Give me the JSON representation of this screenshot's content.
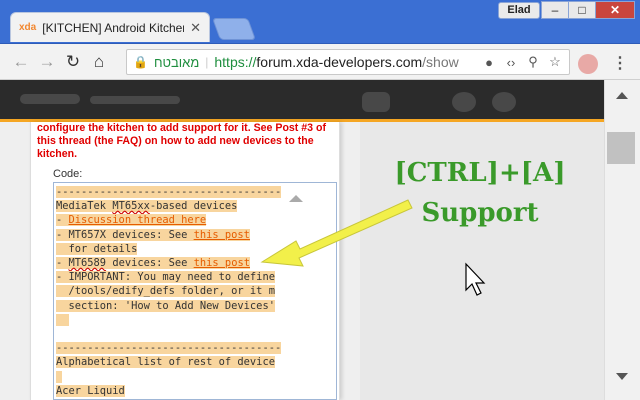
{
  "window": {
    "tab_favicon": "xda",
    "tab_title": "[KITCHEN] Android Kitchen",
    "tab_close": "✕",
    "user": "Elad",
    "minimize": "‒",
    "maximize": "□",
    "close": "✕"
  },
  "toolbar": {
    "back": "←",
    "forward": "→",
    "reload": "↻",
    "home": "⌂",
    "lock": "🔒",
    "secure_label": "מאובטח",
    "url_scheme": "https://",
    "url_host": "forum.xda-developers.com",
    "url_path": "/show",
    "menu": "⋮"
  },
  "post": {
    "red_text": "configure the kitchen to add support for it. See Post #3 of this thread (the FAQ) on how to add new devices to the kitchen.",
    "code_label": "Code:",
    "code": {
      "sep1": "------------------------------------",
      "mtk_prefix": "MediaTek ",
      "mtk_chip": "MT65xx",
      "mtk_suffix": "-based devices",
      "disc_dash": "- ",
      "disc_link": "Discussion thread here",
      "mt657x_text": "- MT657X devices: See ",
      "mt657x_link": "this post",
      "mt657x_details": "  for details",
      "mt6589_dash": "- ",
      "mt6589_chip": "MT6589",
      "mt6589_text": " devices: See ",
      "mt6589_link": "this post",
      "important1": "- IMPORTANT: You may need to define",
      "important2": "  /tools/edify_defs folder, or it m",
      "important3": "  section: 'How to Add New Devices'",
      "sep2": "------------------------------------",
      "alpha": "Alphabetical list of rest of device",
      "acer": "Acer Liquid"
    }
  },
  "annotation": {
    "line1": "[CTRL]+[A]",
    "line2": "Support",
    "color": "#3a9a2a",
    "arrow_color": "#f2f04a"
  }
}
